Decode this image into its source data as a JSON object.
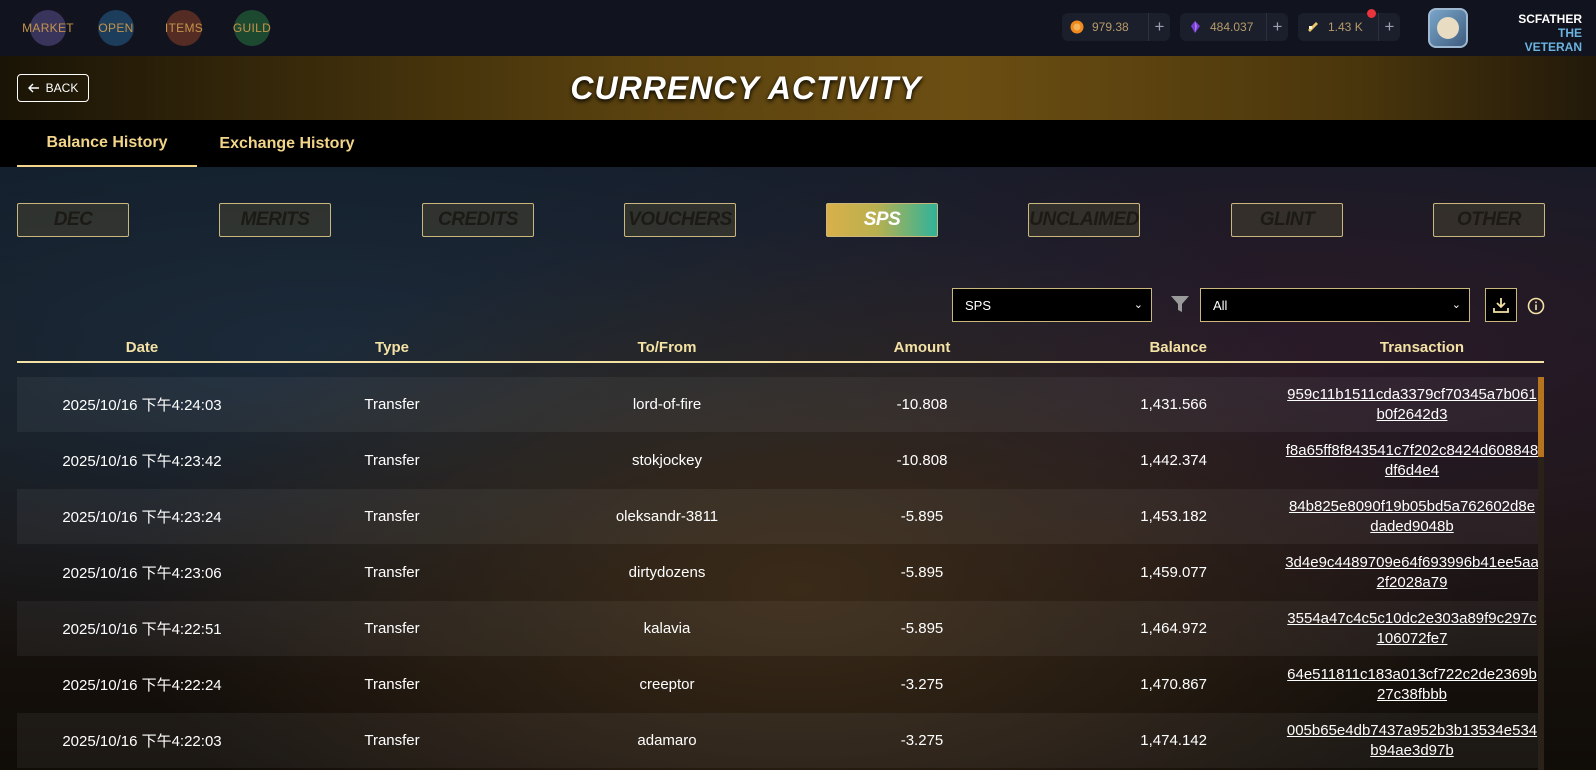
{
  "nav": [
    {
      "label": "MARKET",
      "icon": "market-icon",
      "color": "#6b5aa8"
    },
    {
      "label": "OPEN",
      "icon": "open-pack-icon",
      "color": "#2a6fa8"
    },
    {
      "label": "ITEMS",
      "icon": "items-icon",
      "color": "#a84a2a"
    },
    {
      "label": "GUILD",
      "icon": "guild-icon",
      "color": "#2f8a4a"
    }
  ],
  "wallets": [
    {
      "value": "979.38",
      "icon": "dec-coin-icon",
      "color": "#f08a1c"
    },
    {
      "value": "484.037",
      "icon": "crystal-icon",
      "color": "#7a3fd0"
    },
    {
      "value": "1.43 K",
      "icon": "voucher-icon",
      "color": "#e8c46a"
    }
  ],
  "player": {
    "name": "SCFATHER",
    "title": "THE VETERAN"
  },
  "header": {
    "back_label": "BACK",
    "title": "CURRENCY ACTIVITY"
  },
  "tabs": [
    {
      "label": "Balance History",
      "active": true
    },
    {
      "label": "Exchange History",
      "active": false
    }
  ],
  "currencies": [
    "DEC",
    "MERITS",
    "CREDITS",
    "VOUCHERS",
    "SPS",
    "UNCLAIMED",
    "GLINT",
    "OTHER"
  ],
  "active_currency": "SPS",
  "filters": {
    "token_select": "SPS",
    "type_select": "All"
  },
  "table": {
    "headers": [
      "Date",
      "Type",
      "To/From",
      "Amount",
      "Balance",
      "Transaction"
    ],
    "rows": [
      {
        "date": "2025/10/16 下午4:24:03",
        "type": "Transfer",
        "to_from": "lord-of-fire",
        "amount": "-10.808",
        "balance": "1,431.566",
        "tx": "959c11b1511cda3379cf70345a7b061b0f2642d3"
      },
      {
        "date": "2025/10/16 下午4:23:42",
        "type": "Transfer",
        "to_from": "stokjockey",
        "amount": "-10.808",
        "balance": "1,442.374",
        "tx": "f8a65ff8f843541c7f202c8424d608848df6d4e4"
      },
      {
        "date": "2025/10/16 下午4:23:24",
        "type": "Transfer",
        "to_from": "oleksandr-3811",
        "amount": "-5.895",
        "balance": "1,453.182",
        "tx": "84b825e8090f19b05bd5a762602d8edaded9048b"
      },
      {
        "date": "2025/10/16 下午4:23:06",
        "type": "Transfer",
        "to_from": "dirtydozens",
        "amount": "-5.895",
        "balance": "1,459.077",
        "tx": "3d4e9c4489709e64f693996b41ee5aa2f2028a79"
      },
      {
        "date": "2025/10/16 下午4:22:51",
        "type": "Transfer",
        "to_from": "kalavia",
        "amount": "-5.895",
        "balance": "1,464.972",
        "tx": "3554a47c4c5c10dc2e303a89f9c297c106072fe7"
      },
      {
        "date": "2025/10/16 下午4:22:24",
        "type": "Transfer",
        "to_from": "creeptor",
        "amount": "-3.275",
        "balance": "1,470.867",
        "tx": "64e511811c183a013cf722c2de2369b27c38fbbb"
      },
      {
        "date": "2025/10/16 下午4:22:03",
        "type": "Transfer",
        "to_from": "adamaro",
        "amount": "-3.275",
        "balance": "1,474.142",
        "tx": "005b65e4db7437a952b3b13534e534b94ae3d97b"
      }
    ]
  },
  "colors": {
    "accent_gold": "#f3e2a4",
    "sps_gradient_start": "#d9b04a",
    "sps_gradient_end": "#2fb39a"
  }
}
